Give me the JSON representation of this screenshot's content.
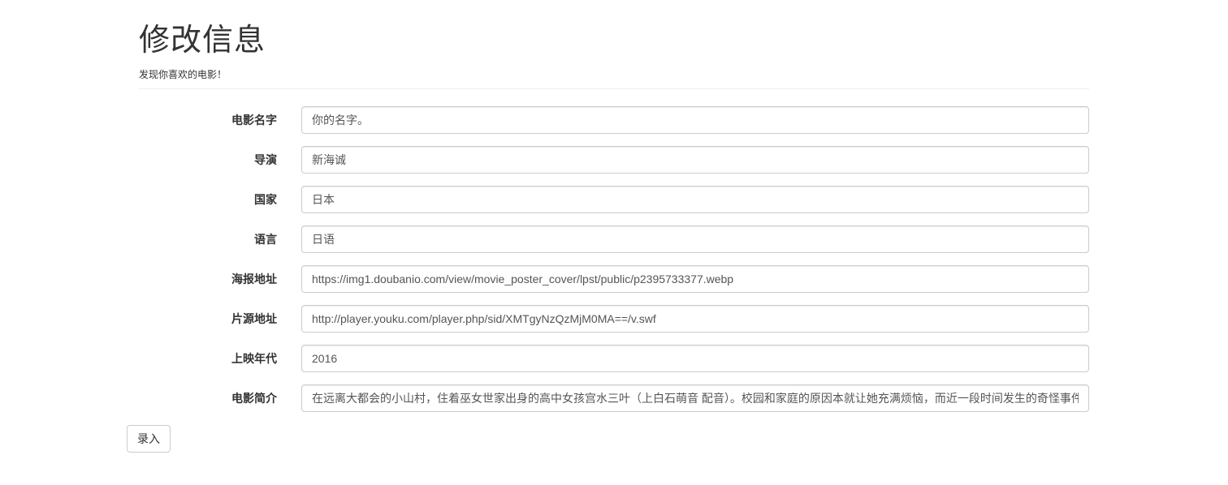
{
  "header": {
    "title": "修改信息",
    "subtitle": "发现你喜欢的电影！"
  },
  "form": {
    "fields": [
      {
        "label": "电影名字",
        "value": "你的名字。"
      },
      {
        "label": "导演",
        "value": "新海诚"
      },
      {
        "label": "国家",
        "value": "日本"
      },
      {
        "label": "语言",
        "value": "日语"
      },
      {
        "label": "海报地址",
        "value": "https://img1.doubanio.com/view/movie_poster_cover/lpst/public/p2395733377.webp"
      },
      {
        "label": "片源地址",
        "value": "http://player.youku.com/player.php/sid/XMTgyNzQzMjM0MA==/v.swf"
      },
      {
        "label": "上映年代",
        "value": "2016"
      },
      {
        "label": "电影简介",
        "value": "在远离大都会的小山村，住着巫女世家出身的高中女孩宫水三叶（上白石萌音 配音）。校园和家庭的原因本就让她充满烦恼，而近一段时间发生的奇怪事件"
      }
    ],
    "submit_label": "录入"
  }
}
